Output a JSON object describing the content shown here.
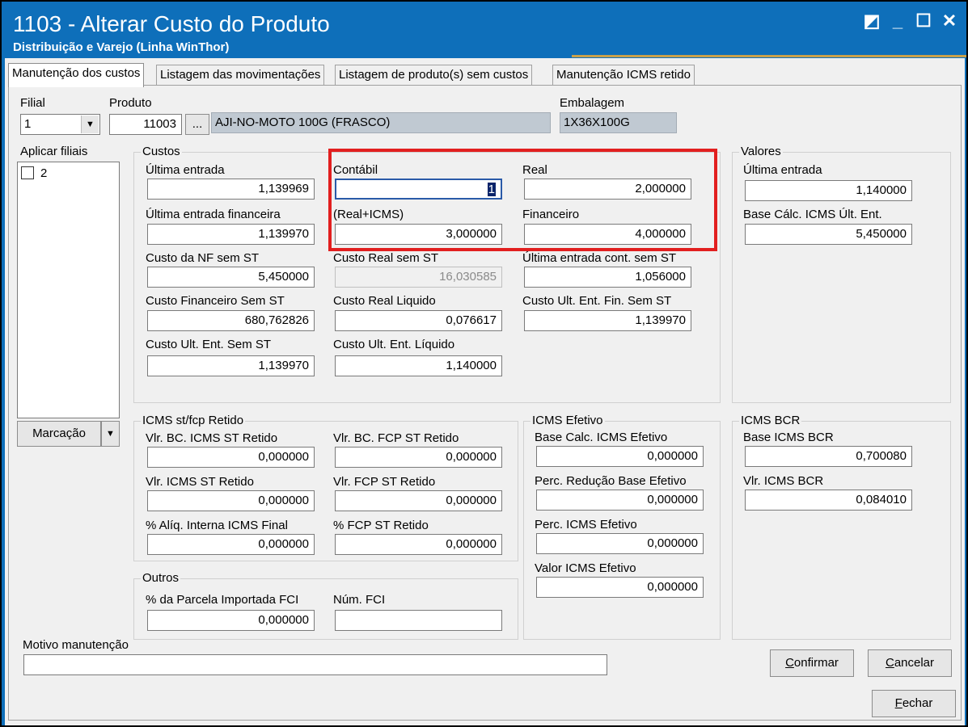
{
  "window": {
    "title": "1103 - Alterar Custo do Produto",
    "subtitle": "Distribuição e Varejo (Linha WinThor)",
    "controls": [
      "◩",
      "_",
      "☐",
      "✕"
    ]
  },
  "tabs": [
    {
      "label": "Manutenção dos custos",
      "active": true
    },
    {
      "label": "Listagem das movimentações"
    },
    {
      "label": "Listagem de produto(s)  sem custos"
    },
    {
      "label": "Manutenção ICMS retido"
    }
  ],
  "header": {
    "filial_label": "Filial",
    "filial_value": "1",
    "produto_label": "Produto",
    "produto_code": "11003",
    "produto_lookup": "...",
    "produto_desc": "AJI-NO-MOTO 100G (FRASCO)",
    "embalagem_label": "Embalagem",
    "embalagem_value": "1X36X100G"
  },
  "filiais": {
    "label": "Aplicar filiais",
    "items": [
      {
        "label": "2",
        "checked": false
      }
    ],
    "marcacao": "Marcação"
  },
  "custos": {
    "title": "Custos",
    "ultima_entrada_label": "Última entrada",
    "ultima_entrada": "1,139969",
    "ultima_entrada_fin_label": "Última entrada financeira",
    "ultima_entrada_fin": "1,139970",
    "custo_nf_sem_st_label": "Custo da NF sem ST",
    "custo_nf_sem_st": "5,450000",
    "custo_fin_sem_st_label": "Custo Financeiro Sem ST",
    "custo_fin_sem_st": "680,762826",
    "custo_ult_ent_sem_st_label": "Custo Ult. Ent. Sem ST",
    "custo_ult_ent_sem_st": "1,139970",
    "contabil_label": "Contábil",
    "contabil": "1",
    "real_icms_label": "(Real+ICMS)",
    "real_icms": "3,000000",
    "custo_real_sem_st_label": "Custo Real sem ST",
    "custo_real_sem_st": "16,030585",
    "custo_real_liquido_label": "Custo Real Liquido",
    "custo_real_liquido": "0,076617",
    "custo_ult_ent_liquido_label": "Custo Ult. Ent. Líquido",
    "custo_ult_ent_liquido": "1,140000",
    "real_label": "Real",
    "real": "2,000000",
    "financeiro_label": "Financeiro",
    "financeiro": "4,000000",
    "ult_ent_cont_sem_st_label": "Última entrada cont. sem ST",
    "ult_ent_cont_sem_st": "1,056000",
    "custo_ult_ent_fin_sem_st_label": "Custo Ult. Ent. Fin. Sem ST",
    "custo_ult_ent_fin_sem_st": "1,139970"
  },
  "valores": {
    "title": "Valores",
    "ultima_entrada_label": "Última entrada",
    "ultima_entrada": "1,140000",
    "base_calc_label": "Base Cálc. ICMS Últ. Ent.",
    "base_calc": "5,450000"
  },
  "icms_st": {
    "title": "ICMS st/fcp Retido",
    "vlr_bc_icms_label": "Vlr. BC. ICMS ST Retido",
    "vlr_bc_icms": "0,000000",
    "vlr_icms_label": "Vlr. ICMS ST Retido",
    "vlr_icms": "0,000000",
    "aliq_label": "% Alíq. Interna ICMS Final",
    "aliq": "0,000000",
    "vlr_bc_fcp_label": "Vlr. BC. FCP ST Retido",
    "vlr_bc_fcp": "0,000000",
    "vlr_fcp_label": "Vlr. FCP ST Retido",
    "vlr_fcp": "0,000000",
    "fcp_pct_label": "% FCP ST Retido",
    "fcp_pct": "0,000000"
  },
  "outros": {
    "title": "Outros",
    "parcela_label": "% da Parcela Importada FCI",
    "parcela": "0,000000",
    "num_fci_label": "Núm. FCI",
    "num_fci": ""
  },
  "icms_efetivo": {
    "title": "ICMS Efetivo",
    "base_label": "Base Calc. ICMS Efetivo",
    "base": "0,000000",
    "perc_red_label": "Perc. Redução Base Efetivo",
    "perc_red": "0,000000",
    "perc_icms_label": "Perc. ICMS Efetivo",
    "perc_icms": "0,000000",
    "valor_label": "Valor ICMS Efetivo",
    "valor": "0,000000"
  },
  "icms_bcr": {
    "title": "ICMS BCR",
    "base_label": "Base ICMS BCR",
    "base": "0,700080",
    "vlr_label": "Vlr. ICMS BCR",
    "vlr": "0,084010"
  },
  "motivo": {
    "label": "Motivo manutenção",
    "value": ""
  },
  "buttons": {
    "confirmar": "Confirmar",
    "cancelar": "Cancelar",
    "fechar": "Fechar"
  },
  "colors": {
    "titlebar": "#0e6fba",
    "highlight": "#e21f1f"
  }
}
